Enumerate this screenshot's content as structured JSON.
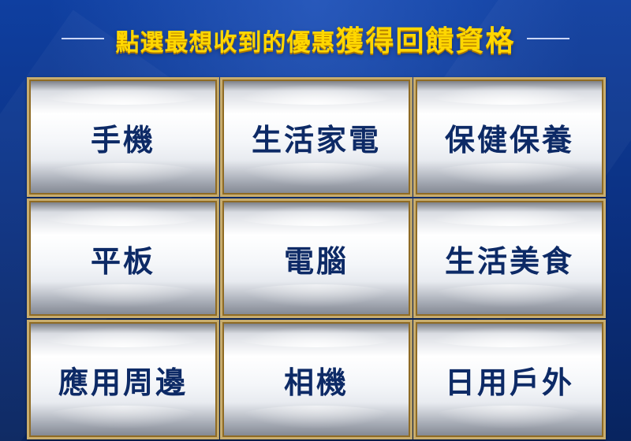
{
  "header": {
    "title_part1": "點選最想收到的優惠",
    "title_part2": "獲得回饋資格"
  },
  "categories": [
    {
      "label": "手機"
    },
    {
      "label": "生活家電"
    },
    {
      "label": "保健保養"
    },
    {
      "label": "平板"
    },
    {
      "label": "電腦"
    },
    {
      "label": "生活美食"
    },
    {
      "label": "應用周邊"
    },
    {
      "label": "相機"
    },
    {
      "label": "日用戶外"
    }
  ],
  "colors": {
    "background": "#0b2f7e",
    "title": "#ffd700",
    "tile_text": "#0d2a66",
    "tile_border": "#c8ad6e"
  }
}
